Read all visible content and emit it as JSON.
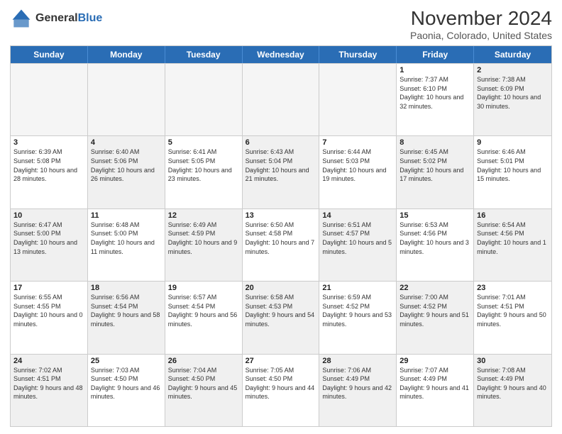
{
  "header": {
    "logo_general": "General",
    "logo_blue": "Blue",
    "month_title": "November 2024",
    "subtitle": "Paonia, Colorado, United States"
  },
  "weekdays": [
    "Sunday",
    "Monday",
    "Tuesday",
    "Wednesday",
    "Thursday",
    "Friday",
    "Saturday"
  ],
  "rows": [
    [
      {
        "day": "",
        "info": "",
        "empty": true
      },
      {
        "day": "",
        "info": "",
        "empty": true
      },
      {
        "day": "",
        "info": "",
        "empty": true
      },
      {
        "day": "",
        "info": "",
        "empty": true
      },
      {
        "day": "",
        "info": "",
        "empty": true
      },
      {
        "day": "1",
        "info": "Sunrise: 7:37 AM\nSunset: 6:10 PM\nDaylight: 10 hours\nand 32 minutes.",
        "empty": false
      },
      {
        "day": "2",
        "info": "Sunrise: 7:38 AM\nSunset: 6:09 PM\nDaylight: 10 hours\nand 30 minutes.",
        "empty": false,
        "shaded": true
      }
    ],
    [
      {
        "day": "3",
        "info": "Sunrise: 6:39 AM\nSunset: 5:08 PM\nDaylight: 10 hours\nand 28 minutes.",
        "empty": false
      },
      {
        "day": "4",
        "info": "Sunrise: 6:40 AM\nSunset: 5:06 PM\nDaylight: 10 hours\nand 26 minutes.",
        "empty": false,
        "shaded": true
      },
      {
        "day": "5",
        "info": "Sunrise: 6:41 AM\nSunset: 5:05 PM\nDaylight: 10 hours\nand 23 minutes.",
        "empty": false
      },
      {
        "day": "6",
        "info": "Sunrise: 6:43 AM\nSunset: 5:04 PM\nDaylight: 10 hours\nand 21 minutes.",
        "empty": false,
        "shaded": true
      },
      {
        "day": "7",
        "info": "Sunrise: 6:44 AM\nSunset: 5:03 PM\nDaylight: 10 hours\nand 19 minutes.",
        "empty": false
      },
      {
        "day": "8",
        "info": "Sunrise: 6:45 AM\nSunset: 5:02 PM\nDaylight: 10 hours\nand 17 minutes.",
        "empty": false,
        "shaded": true
      },
      {
        "day": "9",
        "info": "Sunrise: 6:46 AM\nSunset: 5:01 PM\nDaylight: 10 hours\nand 15 minutes.",
        "empty": false
      }
    ],
    [
      {
        "day": "10",
        "info": "Sunrise: 6:47 AM\nSunset: 5:00 PM\nDaylight: 10 hours\nand 13 minutes.",
        "empty": false,
        "shaded": true
      },
      {
        "day": "11",
        "info": "Sunrise: 6:48 AM\nSunset: 5:00 PM\nDaylight: 10 hours\nand 11 minutes.",
        "empty": false
      },
      {
        "day": "12",
        "info": "Sunrise: 6:49 AM\nSunset: 4:59 PM\nDaylight: 10 hours\nand 9 minutes.",
        "empty": false,
        "shaded": true
      },
      {
        "day": "13",
        "info": "Sunrise: 6:50 AM\nSunset: 4:58 PM\nDaylight: 10 hours\nand 7 minutes.",
        "empty": false
      },
      {
        "day": "14",
        "info": "Sunrise: 6:51 AM\nSunset: 4:57 PM\nDaylight: 10 hours\nand 5 minutes.",
        "empty": false,
        "shaded": true
      },
      {
        "day": "15",
        "info": "Sunrise: 6:53 AM\nSunset: 4:56 PM\nDaylight: 10 hours\nand 3 minutes.",
        "empty": false
      },
      {
        "day": "16",
        "info": "Sunrise: 6:54 AM\nSunset: 4:56 PM\nDaylight: 10 hours\nand 1 minute.",
        "empty": false,
        "shaded": true
      }
    ],
    [
      {
        "day": "17",
        "info": "Sunrise: 6:55 AM\nSunset: 4:55 PM\nDaylight: 10 hours\nand 0 minutes.",
        "empty": false
      },
      {
        "day": "18",
        "info": "Sunrise: 6:56 AM\nSunset: 4:54 PM\nDaylight: 9 hours\nand 58 minutes.",
        "empty": false,
        "shaded": true
      },
      {
        "day": "19",
        "info": "Sunrise: 6:57 AM\nSunset: 4:54 PM\nDaylight: 9 hours\nand 56 minutes.",
        "empty": false
      },
      {
        "day": "20",
        "info": "Sunrise: 6:58 AM\nSunset: 4:53 PM\nDaylight: 9 hours\nand 54 minutes.",
        "empty": false,
        "shaded": true
      },
      {
        "day": "21",
        "info": "Sunrise: 6:59 AM\nSunset: 4:52 PM\nDaylight: 9 hours\nand 53 minutes.",
        "empty": false
      },
      {
        "day": "22",
        "info": "Sunrise: 7:00 AM\nSunset: 4:52 PM\nDaylight: 9 hours\nand 51 minutes.",
        "empty": false,
        "shaded": true
      },
      {
        "day": "23",
        "info": "Sunrise: 7:01 AM\nSunset: 4:51 PM\nDaylight: 9 hours\nand 50 minutes.",
        "empty": false
      }
    ],
    [
      {
        "day": "24",
        "info": "Sunrise: 7:02 AM\nSunset: 4:51 PM\nDaylight: 9 hours\nand 48 minutes.",
        "empty": false,
        "shaded": true
      },
      {
        "day": "25",
        "info": "Sunrise: 7:03 AM\nSunset: 4:50 PM\nDaylight: 9 hours\nand 46 minutes.",
        "empty": false
      },
      {
        "day": "26",
        "info": "Sunrise: 7:04 AM\nSunset: 4:50 PM\nDaylight: 9 hours\nand 45 minutes.",
        "empty": false,
        "shaded": true
      },
      {
        "day": "27",
        "info": "Sunrise: 7:05 AM\nSunset: 4:50 PM\nDaylight: 9 hours\nand 44 minutes.",
        "empty": false
      },
      {
        "day": "28",
        "info": "Sunrise: 7:06 AM\nSunset: 4:49 PM\nDaylight: 9 hours\nand 42 minutes.",
        "empty": false,
        "shaded": true
      },
      {
        "day": "29",
        "info": "Sunrise: 7:07 AM\nSunset: 4:49 PM\nDaylight: 9 hours\nand 41 minutes.",
        "empty": false
      },
      {
        "day": "30",
        "info": "Sunrise: 7:08 AM\nSunset: 4:49 PM\nDaylight: 9 hours\nand 40 minutes.",
        "empty": false,
        "shaded": true
      }
    ]
  ]
}
